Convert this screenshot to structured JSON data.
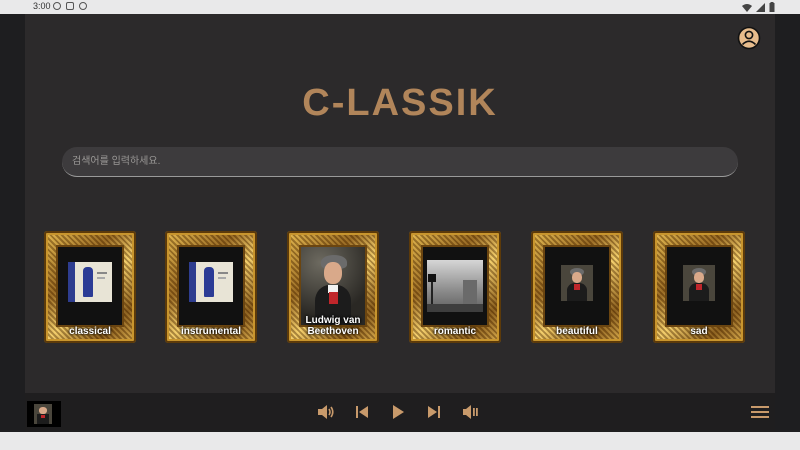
{
  "status_bar": {
    "time": "3:00"
  },
  "app": {
    "title": "C-LASSIK",
    "search": {
      "placeholder": "검색어를 입력하세요.",
      "value": ""
    },
    "cards": [
      {
        "label": "classical",
        "art": "album-cover"
      },
      {
        "label": "instrumental",
        "art": "album-cover"
      },
      {
        "label": "Ludwig van Beethoven",
        "art": "beethoven-portrait"
      },
      {
        "label": "romantic",
        "art": "grayscale-street"
      },
      {
        "label": "beautiful",
        "art": "beethoven-portrait-small"
      },
      {
        "label": "sad",
        "art": "beethoven-portrait-small"
      }
    ],
    "player": {
      "controls": [
        "volume-up-icon",
        "previous-icon",
        "play-icon",
        "next-icon",
        "volume-mute-icon"
      ],
      "menu_icon": "hamburger-menu-icon"
    }
  },
  "colors": {
    "accent": "#b1855a",
    "background": "#2c2a2b",
    "bottom_bar": "#1f1e1f",
    "search": "#3d3b3d"
  }
}
